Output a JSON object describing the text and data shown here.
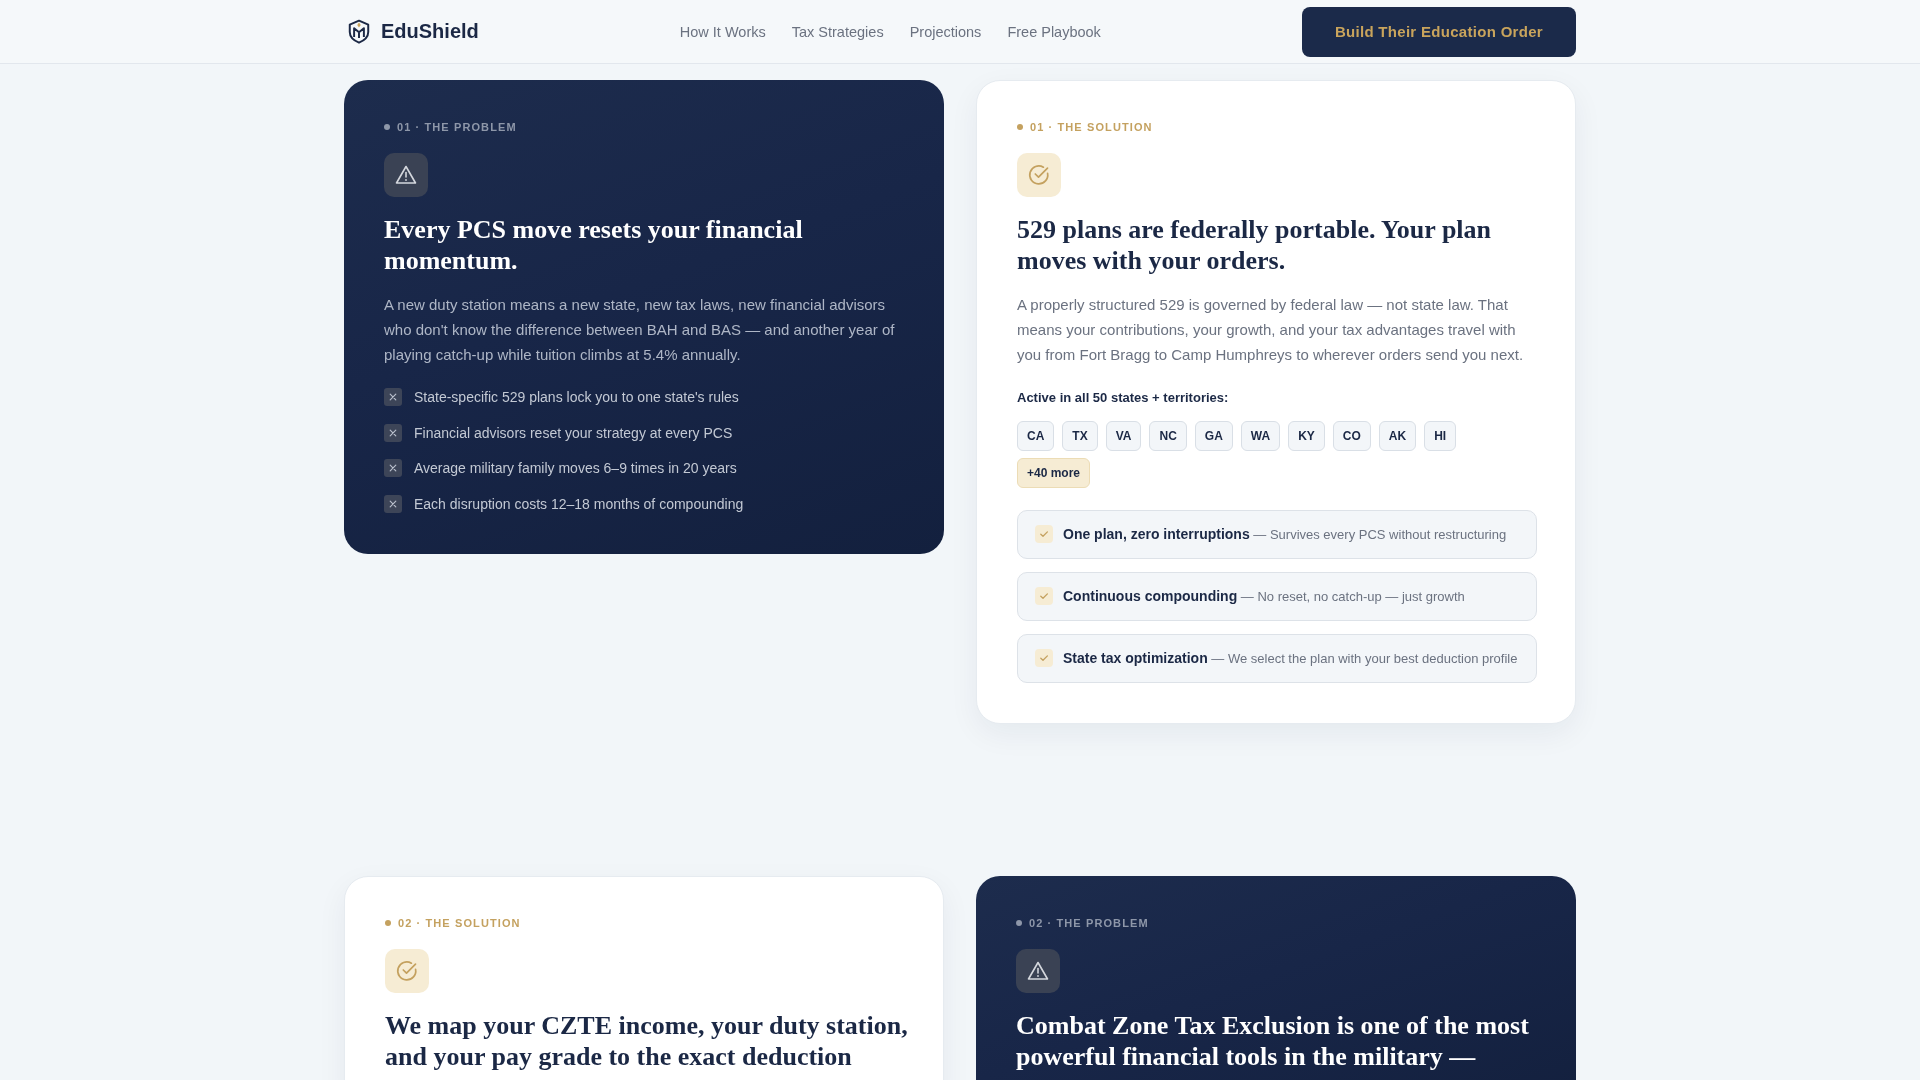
{
  "header": {
    "brand": "EduShield",
    "nav": [
      "How It Works",
      "Tax Strategies",
      "Projections",
      "Free Playbook"
    ],
    "cta": "Build Their Education Order"
  },
  "rows": [
    {
      "cards": [
        {
          "kind": "problem",
          "label": "01 · THE PROBLEM",
          "heading": "Every PCS move resets your financial momentum.",
          "body": "A new duty station means a new state, new tax laws, new financial advisors who don't know the difference between BAH and BAS — and another year of playing catch-up while tuition climbs at 5.4% annually.",
          "points": [
            "State-specific 529 plans lock you to one state's rules",
            "Financial advisors reset your strategy at every PCS",
            "Average military family moves 6–9 times in 20 years",
            "Each disruption costs 12–18 months of compounding"
          ]
        },
        {
          "kind": "solution",
          "label": "01 · THE SOLUTION",
          "heading": "529 plans are federally portable. Your plan moves with your orders.",
          "body": "A properly structured 529 is governed by federal law — not state law. That means your contributions, your growth, and your tax advantages travel with you from Fort Bragg to Camp Humphreys to wherever orders send you next.",
          "states_label": "Active in all 50 states + territories:",
          "states": [
            "CA",
            "TX",
            "VA",
            "NC",
            "GA",
            "WA",
            "KY",
            "CO",
            "AK",
            "HI"
          ],
          "more_states": "+40 more",
          "features": [
            "**One plan, zero interruptions** — Survives every PCS without restructuring",
            "**Continuous compounding** — No reset, no catch-up — just growth",
            "**State tax optimization** — We select the plan with your best deduction profile"
          ]
        }
      ]
    },
    {
      "cards": [
        {
          "kind": "solution",
          "label": "02 · THE SOLUTION",
          "heading": "We map your CZTE income, your duty station, and your pay grade to the exact deduction"
        },
        {
          "kind": "problem",
          "label": "02 · THE PROBLEM",
          "heading": "Combat Zone Tax Exclusion is one of the most powerful financial tools in the military —"
        }
      ]
    }
  ]
}
